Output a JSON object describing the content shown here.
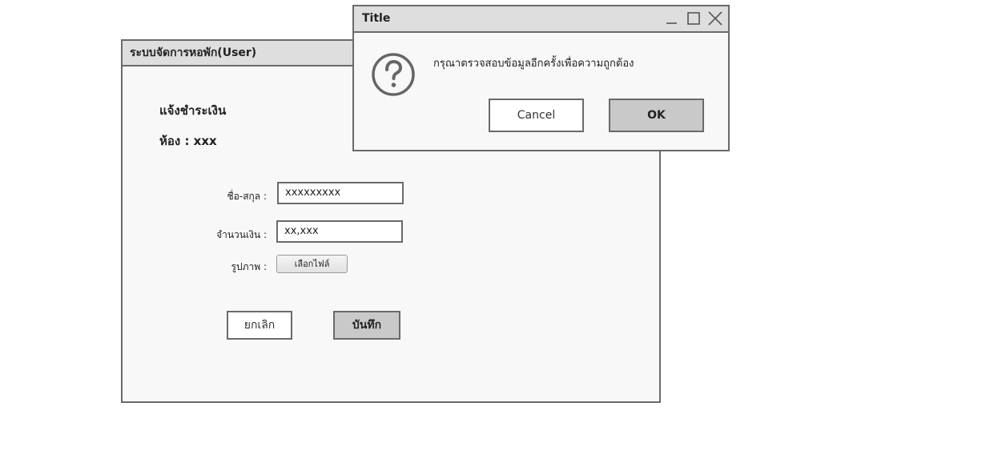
{
  "main_window": {
    "title": "ระบบจัดการหอพัก(User)",
    "heading": "แจ้งชำระเงิน",
    "room": "ห้อง : xxx",
    "fields": {
      "name_label": "ชื่อ-สกุล :",
      "name_value": "xxxxxxxxx",
      "amount_label": "จำนวนเงิน :",
      "amount_value": "xx,xxx",
      "image_label": "รูปภาพ :",
      "file_button": "เลือกไฟล์"
    },
    "buttons": {
      "cancel": "ยกเลิก",
      "save": "บันทึก"
    }
  },
  "dialog": {
    "title": "Title",
    "icon": "question-icon",
    "message": "กรุณาตรวจสอบข้อมูลอีกครั้งเพื่อความถูกต้อง",
    "cancel_label": "Cancel",
    "ok_label": "OK",
    "controls": [
      "minimize-icon",
      "maximize-icon",
      "close-icon"
    ]
  },
  "colors": {
    "border": "#6a6a6a",
    "titlebar": "#dedede",
    "panel": "#f8f8f8",
    "primary_button": "#c9c9c9"
  }
}
